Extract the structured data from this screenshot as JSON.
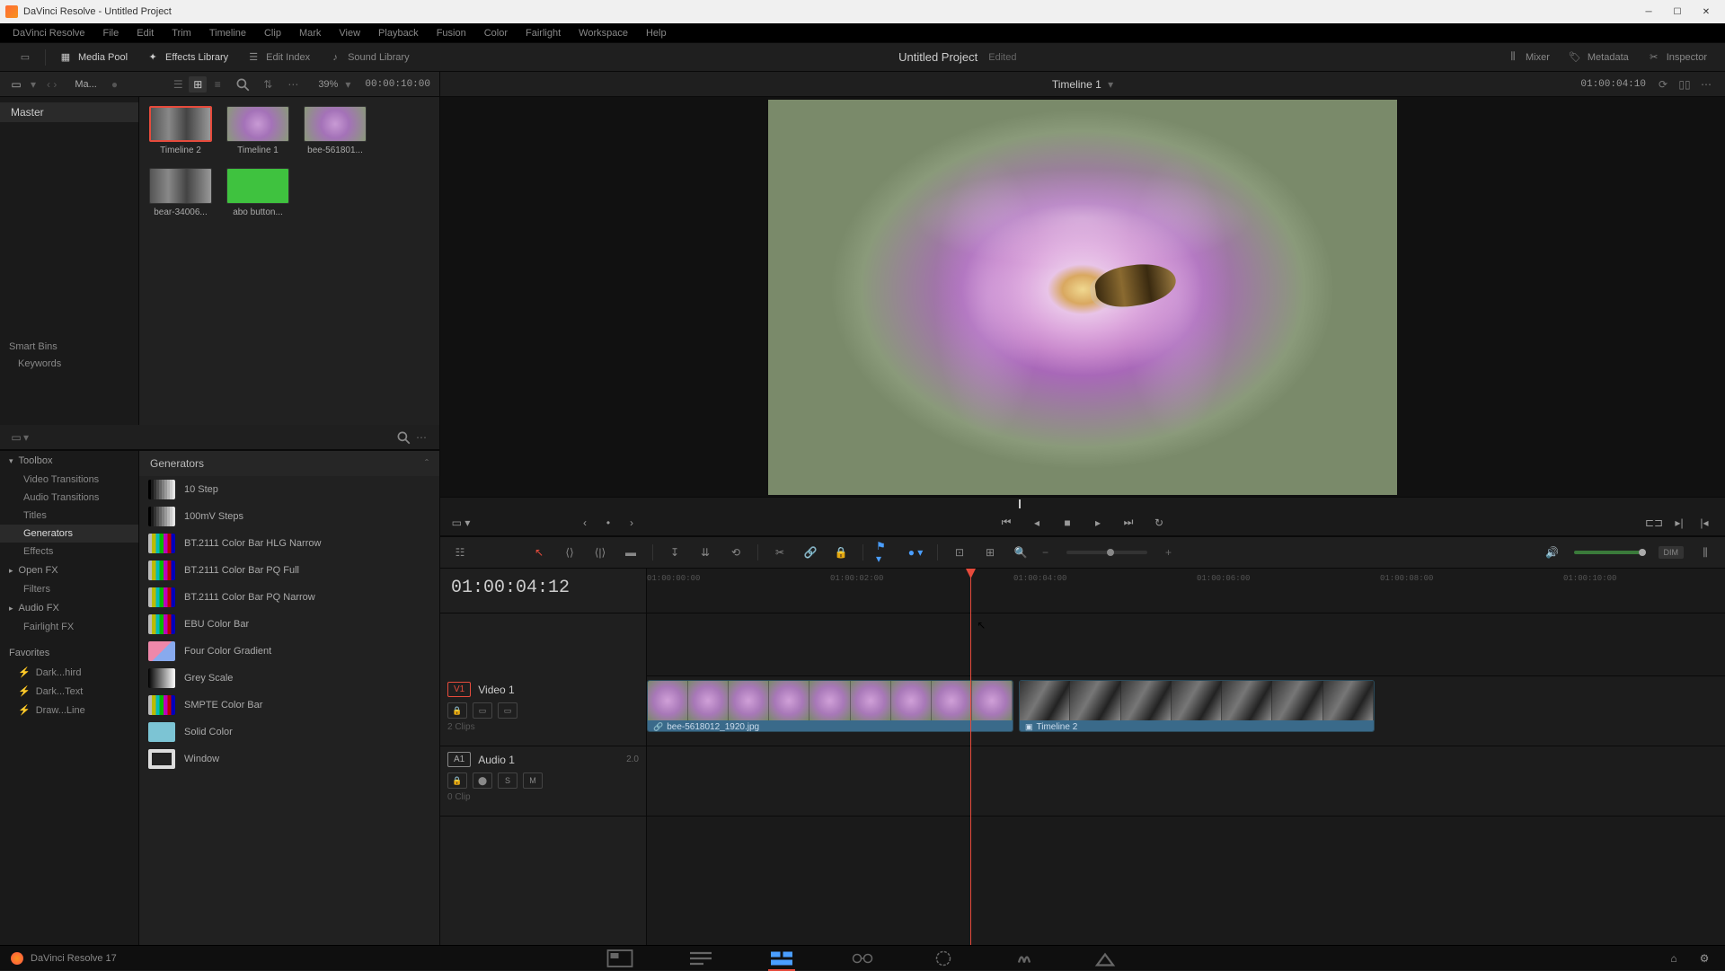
{
  "window": {
    "title": "DaVinci Resolve - Untitled Project"
  },
  "menu": [
    "DaVinci Resolve",
    "File",
    "Edit",
    "Trim",
    "Timeline",
    "Clip",
    "Mark",
    "View",
    "Playback",
    "Fusion",
    "Color",
    "Fairlight",
    "Workspace",
    "Help"
  ],
  "toolbar": {
    "media_pool": "Media Pool",
    "effects_library": "Effects Library",
    "edit_index": "Edit Index",
    "sound_library": "Sound Library",
    "mixer": "Mixer",
    "metadata": "Metadata",
    "inspector": "Inspector"
  },
  "project": {
    "title": "Untitled Project",
    "status": "Edited"
  },
  "pool": {
    "tab": "Ma...",
    "bin": "Master",
    "smart_bins": "Smart Bins",
    "keywords": "Keywords",
    "zoom_pct": "39%",
    "src_tc": "00:00:10:00",
    "items": [
      {
        "label": "Timeline 2",
        "kind": "timeline-bw",
        "selected": true
      },
      {
        "label": "Timeline 1",
        "kind": "timeline-flower"
      },
      {
        "label": "bee-561801...",
        "kind": "flower"
      },
      {
        "label": "bear-34006...",
        "kind": "bw"
      },
      {
        "label": "abo button...",
        "kind": "green"
      }
    ]
  },
  "fx": {
    "categories": {
      "toolbox": "Toolbox",
      "video_transitions": "Video Transitions",
      "audio_transitions": "Audio Transitions",
      "titles": "Titles",
      "generators": "Generators",
      "effects": "Effects",
      "openfx": "Open FX",
      "filters": "Filters",
      "audiofx": "Audio FX",
      "fairlightfx": "Fairlight FX"
    },
    "favorites_hdr": "Favorites",
    "favorites": [
      "Dark...hird",
      "Dark...Text",
      "Draw...Line"
    ],
    "list_header": "Generators",
    "items": [
      {
        "name": "10 Step",
        "swatch": "sw-10step"
      },
      {
        "name": "100mV Steps",
        "swatch": "sw-10step"
      },
      {
        "name": "BT.2111 Color Bar HLG Narrow",
        "swatch": "sw-bars"
      },
      {
        "name": "BT.2111 Color Bar PQ Full",
        "swatch": "sw-bars"
      },
      {
        "name": "BT.2111 Color Bar PQ Narrow",
        "swatch": "sw-bars"
      },
      {
        "name": "EBU Color Bar",
        "swatch": "sw-bars"
      },
      {
        "name": "Four Color Gradient",
        "swatch": "sw-4color"
      },
      {
        "name": "Grey Scale",
        "swatch": "sw-grey"
      },
      {
        "name": "SMPTE Color Bar",
        "swatch": "sw-bars"
      },
      {
        "name": "Solid Color",
        "swatch": "sw-solid"
      },
      {
        "name": "Window",
        "swatch": "sw-window"
      }
    ]
  },
  "viewer": {
    "title": "Timeline 1",
    "record_tc": "01:00:04:10"
  },
  "timeline": {
    "current_tc": "01:00:04:12",
    "playhead_pct": 30,
    "ruler": [
      "01:00:00:00",
      "01:00:02:00",
      "01:00:04:00",
      "01:00:06:00",
      "01:00:08:00",
      "01:00:10:00"
    ],
    "video_track": {
      "badge": "V1",
      "name": "Video 1",
      "info": "2 Clips"
    },
    "audio_track": {
      "badge": "A1",
      "name": "Audio 1",
      "db": "2.0",
      "info": "0 Clip"
    },
    "clip1": {
      "label": "bee-5618012_1920.jpg",
      "left_pct": 0,
      "width_pct": 34
    },
    "clip2": {
      "label": "Timeline 2",
      "left_pct": 34.5,
      "width_pct": 33
    },
    "dim": "DIM"
  },
  "footer": {
    "version": "DaVinci Resolve 17"
  }
}
